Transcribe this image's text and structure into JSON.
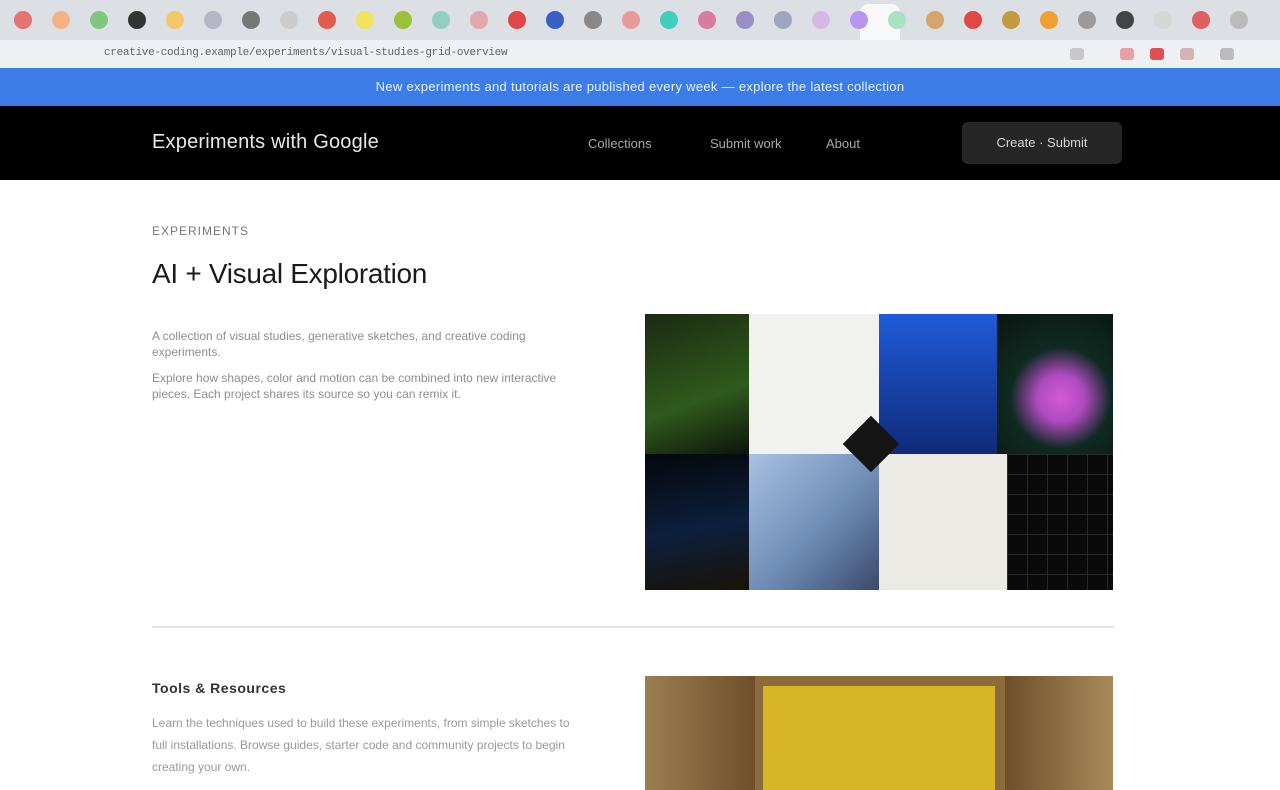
{
  "browser": {
    "url": "creative-coding.example/experiments/visual-studies-grid-overview",
    "tab_colors": [
      "#e57373",
      "#f4b183",
      "#7fc77f",
      "#333333",
      "#f3c86a",
      "#b6b6c8",
      "#777777",
      "#cccccc",
      "#e35b4a",
      "#f2e35c",
      "#99c23a",
      "#8fd0c2",
      "#e0a8a8",
      "#e04848",
      "#3860c4",
      "#888888",
      "#e89a9a",
      "#3fcfbd",
      "#d97b9f",
      "#9a8ec6",
      "#9fa6c0",
      "#d6b8e6",
      "#b995f0",
      "#a7e3c1",
      "#d6a56c",
      "#e04848",
      "#c49a3c",
      "#f0a030",
      "#9b9b9b",
      "#444444",
      "#d6d6d6",
      "#e06060",
      "#bbbbbb"
    ]
  },
  "banner": {
    "text": "New experiments and tutorials are published every week — explore the latest collection"
  },
  "nav": {
    "logo": "Experiments with Google",
    "links": [
      "Collections",
      "Submit work",
      "About"
    ],
    "cta": "Create · Submit"
  },
  "feature": {
    "eyebrow": "EXPERIMENTS",
    "title": "AI + Visual Exploration",
    "paragraph1": "A collection of visual studies, generative sketches, and creative coding experiments.",
    "paragraph2": "Explore how shapes, color and motion can be combined into new interactive pieces. Each project shares its source so you can remix it.",
    "image_label": "experiment-thumbnail-mosaic"
  },
  "section2": {
    "title": "Tools & Resources",
    "body": "Learn the techniques used to build these experiments, from simple sketches to full installations. Browse guides, starter code and community projects to begin creating your own."
  },
  "colors": {
    "banner": "#3c7ce6",
    "nav_bg": "#000000",
    "accent_photo": "#d8b526"
  }
}
